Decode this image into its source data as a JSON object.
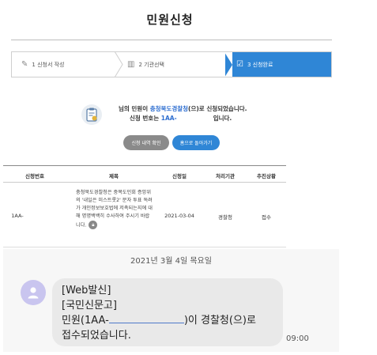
{
  "page": {
    "title": "민원신청"
  },
  "steps": [
    {
      "label": "1 신청서 작성",
      "icon": "pencil-icon"
    },
    {
      "label": "2 기관선택",
      "icon": "building-icon"
    },
    {
      "label": "3 신청완료",
      "icon": "document-check-icon"
    }
  ],
  "result": {
    "line1_pre": "님의 민원이 ",
    "line1_agency": "충청북도경찰청",
    "line1_post": "(으)로 신청되었습니다.",
    "line2_pre": "신청 번호는 ",
    "line2_number": "1AA-",
    "line2_post": "입니다."
  },
  "buttons": {
    "history": "신청 내역 확인",
    "home": "홈으로 돌아가기"
  },
  "table": {
    "headers": [
      "신청번호",
      "제목",
      "신청일",
      "처리기관",
      "추진상황"
    ],
    "row": {
      "number": "1AA-",
      "title": "충청북도경찰청은 중복도민회 증앙위의 '내일은 미스트롯2' 문자 투표 독려가 개인정보보호법에 저촉되는지에 대해 명명백백히 수사하여 주시기 바랍니다.",
      "date": "2021-03-04",
      "agency": "경찰청",
      "status": "접수"
    }
  },
  "chat": {
    "date": "2021년 3월 4일 목요일",
    "line1": "[Web발신]",
    "line2": "[국민신문고]",
    "line3_pre": "민원(1AA-",
    "line3_post": ")이 경찰청(으)로",
    "line4": "접수되었습니다.",
    "time": "09:00"
  }
}
